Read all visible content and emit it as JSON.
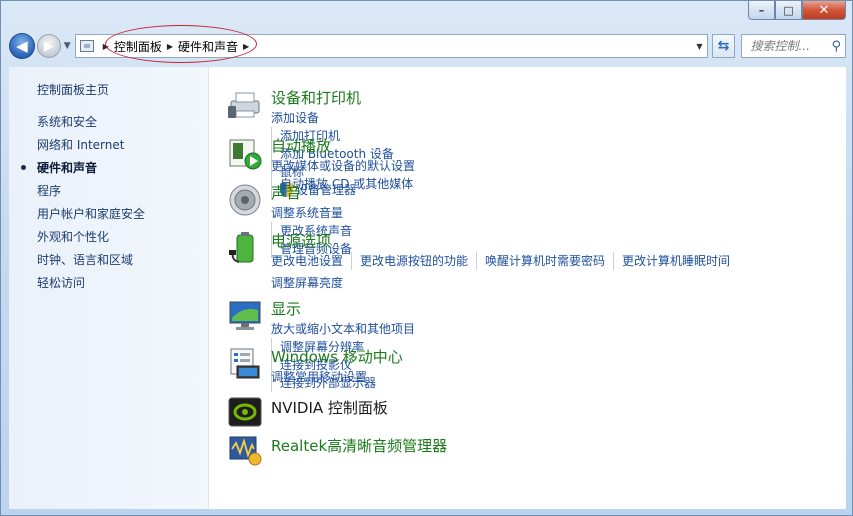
{
  "window": {
    "caption": {
      "minimize": "–",
      "maximize": "□",
      "close": "✕"
    }
  },
  "nav": {
    "back_icon": "arrow-left-icon",
    "forward_icon": "arrow-right-icon",
    "breadcrumb": [
      "控制面板",
      "硬件和声音"
    ],
    "search_placeholder": "搜索控制...",
    "refresh_icon": "refresh-icon"
  },
  "sidebar": {
    "home": "控制面板主页",
    "items": [
      {
        "label": "系统和安全",
        "active": false
      },
      {
        "label": "网络和 Internet",
        "active": false
      },
      {
        "label": "硬件和声音",
        "active": true
      },
      {
        "label": "程序",
        "active": false
      },
      {
        "label": "用户帐户和家庭安全",
        "active": false
      },
      {
        "label": "外观和个性化",
        "active": false
      },
      {
        "label": "时钟、语言和区域",
        "active": false
      },
      {
        "label": "轻松访问",
        "active": false
      }
    ]
  },
  "sections": [
    {
      "title": "设备和打印机",
      "icon": "printer-icon",
      "links": [
        "添加设备",
        "添加打印机",
        "添加 Bluetooth 设备",
        "鼠标",
        "设备管理器"
      ]
    },
    {
      "title": "自动播放",
      "icon": "autoplay-icon",
      "links": [
        "更改媒体或设备的默认设置",
        "自动播放 CD 或其他媒体"
      ]
    },
    {
      "title": "声音",
      "icon": "speaker-icon",
      "links": [
        "调整系统音量",
        "更改系统声音",
        "管理音频设备"
      ]
    },
    {
      "title": "电源选项",
      "icon": "battery-icon",
      "links": [
        "更改电池设置",
        "更改电源按钮的功能",
        "唤醒计算机时需要密码",
        "更改计算机睡眠时间",
        "调整屏幕亮度"
      ]
    },
    {
      "title": "显示",
      "icon": "display-icon",
      "links": [
        "放大或缩小文本和其他项目",
        "调整屏幕分辨率",
        "连接到投影仪",
        "连接到外部显示器"
      ]
    },
    {
      "title": "Windows 移动中心",
      "icon": "mobility-center-icon",
      "links": [
        "调整常用移动设置"
      ]
    },
    {
      "title": "NVIDIA 控制面板",
      "icon": "nvidia-icon",
      "links": []
    },
    {
      "title": "Realtek高清晰音频管理器",
      "icon": "realtek-audio-icon",
      "links": []
    }
  ]
}
